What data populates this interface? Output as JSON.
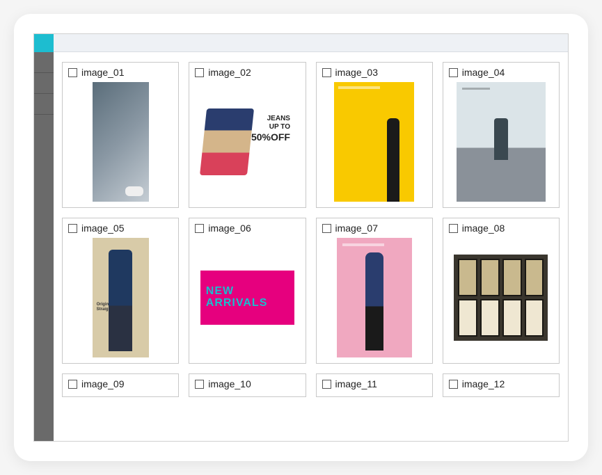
{
  "grid": {
    "items": [
      {
        "label": "image_01",
        "checked": false,
        "thumb": "ph-01"
      },
      {
        "label": "image_02",
        "checked": false,
        "thumb": "ph-02",
        "promo_line1": "JEANS",
        "promo_line2": "UP TO",
        "promo_line3": "50%OFF"
      },
      {
        "label": "image_03",
        "checked": false,
        "thumb": "ph-03"
      },
      {
        "label": "image_04",
        "checked": false,
        "thumb": "ph-04"
      },
      {
        "label": "image_05",
        "checked": false,
        "thumb": "ph-05",
        "caption_line1": "Original",
        "caption_line2": "Straight Jeans"
      },
      {
        "label": "image_06",
        "checked": false,
        "thumb": "ph-06",
        "banner_line1": "NEW",
        "banner_line2": "ARRIVALS"
      },
      {
        "label": "image_07",
        "checked": false,
        "thumb": "ph-07"
      },
      {
        "label": "image_08",
        "checked": false,
        "thumb": "ph-08"
      },
      {
        "label": "image_09",
        "checked": false,
        "thumb": null
      },
      {
        "label": "image_10",
        "checked": false,
        "thumb": null
      },
      {
        "label": "image_11",
        "checked": false,
        "thumb": null
      },
      {
        "label": "image_12",
        "checked": false,
        "thumb": null
      }
    ]
  }
}
